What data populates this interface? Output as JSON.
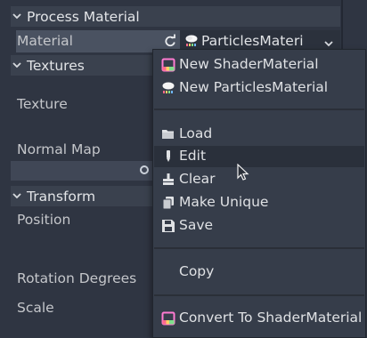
{
  "inspector": {
    "process_material_header": "Process Material",
    "material_label": "Material",
    "material_value": "ParticlesMateri",
    "textures_header": "Textures",
    "texture_label": "Texture",
    "normal_map_label": "Normal Map",
    "transform_header": "Transform",
    "position_label": "Position",
    "rotation_label": "Rotation Degrees",
    "scale_label": "Scale"
  },
  "menu": {
    "items": [
      {
        "label": "New ShaderMaterial",
        "icon": "shader-material-icon"
      },
      {
        "label": "New ParticlesMaterial",
        "icon": "particles-material-icon"
      },
      {
        "label": "Load",
        "icon": "folder-icon"
      },
      {
        "label": "Edit",
        "icon": "edit-icon"
      },
      {
        "label": "Clear",
        "icon": "clear-icon"
      },
      {
        "label": "Make Unique",
        "icon": "duplicate-icon"
      },
      {
        "label": "Save",
        "icon": "save-icon"
      },
      {
        "label": "Copy",
        "icon": ""
      },
      {
        "label": "Convert To ShaderMaterial",
        "icon": "shader-material-icon"
      }
    ],
    "hovered": "Edit"
  },
  "colors": {
    "panel_bg": "#2f3542",
    "header_bg": "#3a414e",
    "popup_bg": "#363d4a",
    "hover_bg": "#2a303b",
    "text": "#dfe1e4"
  }
}
